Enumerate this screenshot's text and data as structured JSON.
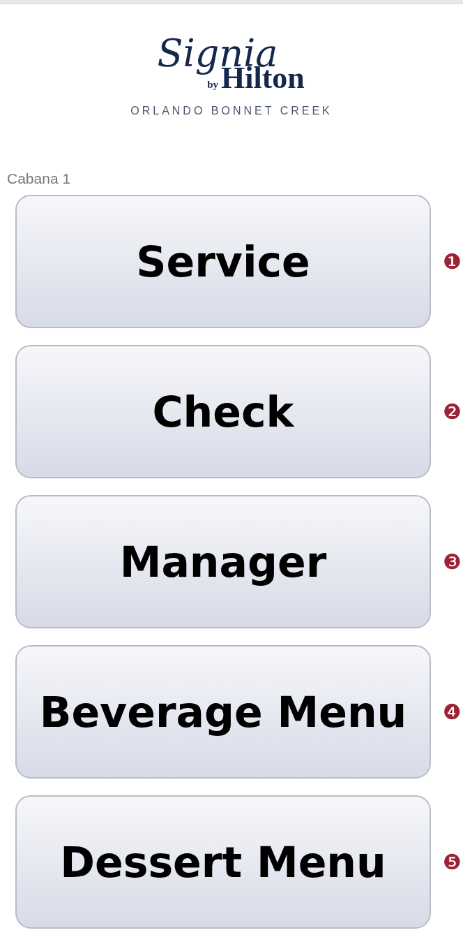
{
  "logo": {
    "script": "Signia",
    "by": "by",
    "brand": "Hilton",
    "location": "ORLANDO BONNET CREEK"
  },
  "location_label": "Cabana 1",
  "buttons": [
    {
      "label": "Service",
      "marker": "❶"
    },
    {
      "label": "Check",
      "marker": "❷"
    },
    {
      "label": "Manager",
      "marker": "❸"
    },
    {
      "label": "Beverage Menu",
      "marker": "❹"
    },
    {
      "label": "Dessert Menu",
      "marker": "❺"
    }
  ]
}
